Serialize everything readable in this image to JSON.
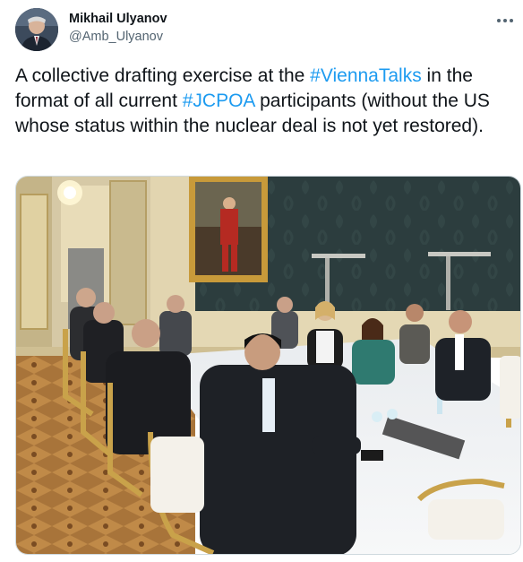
{
  "author": {
    "display_name": "Mikhail Ulyanov",
    "handle": "@Amb_Ulyanov",
    "avatar_icon": "avatar-photo"
  },
  "tweet": {
    "segments": [
      {
        "text": "A collective drafting exercise at the ",
        "link": false
      },
      {
        "text": "#ViennaTalks",
        "link": true
      },
      {
        "text": " in the format of all current ",
        "link": false
      },
      {
        "text": "#JCPOA",
        "link": true
      },
      {
        "text": " participants (without the US whose status within the nuclear deal is not yet restored).",
        "link": false
      }
    ]
  },
  "media": {
    "icon": "photo-meeting-room"
  },
  "colors": {
    "link": "#1d9bf0",
    "text": "#0f1419",
    "secondary": "#536471"
  }
}
